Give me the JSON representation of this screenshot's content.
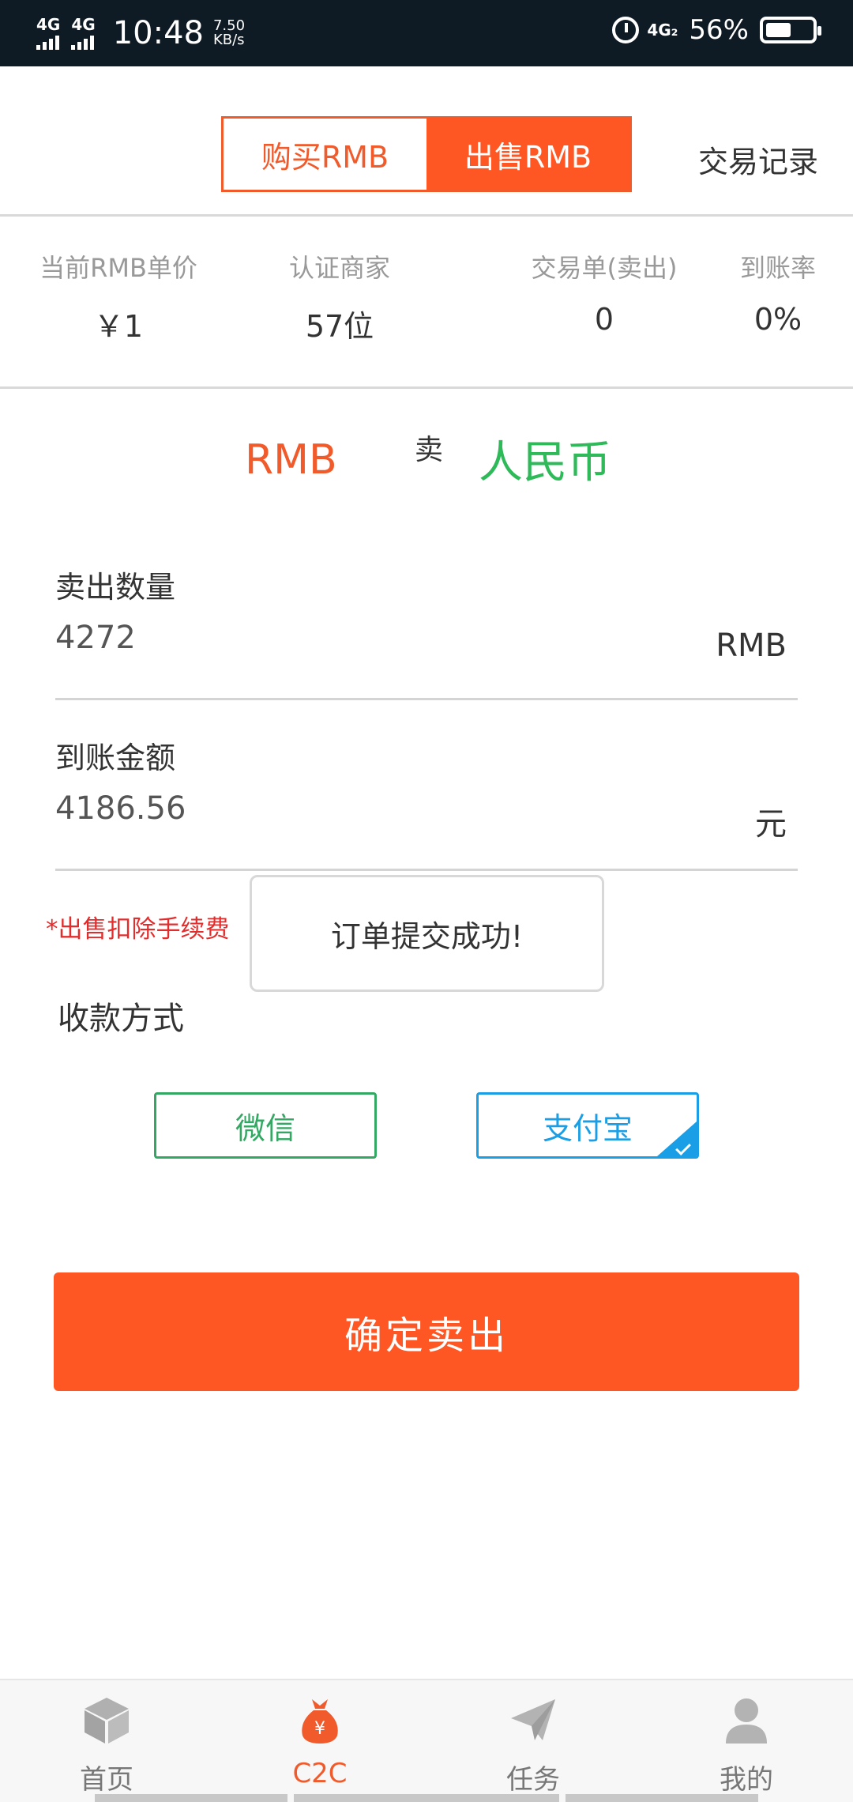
{
  "status_bar": {
    "signal1": "4G",
    "signal2": "4G",
    "time": "10:48",
    "speed_value": "7.50",
    "speed_unit": "KB/s",
    "network": "4G₂",
    "battery_percent": "56%",
    "battery_level": 0.56
  },
  "header": {
    "tab_buy": "购买RMB",
    "tab_sell": "出售RMB",
    "records": "交易记录",
    "active_tab": "sell",
    "accent_color": "#ff5724"
  },
  "stats": [
    {
      "label": "当前RMB单价",
      "value": "￥1"
    },
    {
      "label": "认证商家",
      "value": "57位"
    },
    {
      "label": "交易单(卖出)",
      "value": "0"
    },
    {
      "label": "到账率",
      "value": "0%"
    }
  ],
  "pair": {
    "left": "RMB",
    "mid": "卖",
    "right": "人民币"
  },
  "form": {
    "qty_label": "卖出数量",
    "qty_value": "4272",
    "qty_unit": "RMB",
    "amount_label": "到账金额",
    "amount_value": "4186.56",
    "amount_unit": "元",
    "fee_note": "*出售扣除手续费",
    "pay_label": "收款方式",
    "pay_wechat": "微信",
    "pay_alipay": "支付宝",
    "pay_selected": "alipay"
  },
  "confirm_button": "确定卖出",
  "toast": "订单提交成功!",
  "bottom_nav": [
    {
      "label": "首页",
      "icon": "cube-icon"
    },
    {
      "label": "C2C",
      "icon": "money-bag-icon"
    },
    {
      "label": "任务",
      "icon": "paper-plane-icon"
    },
    {
      "label": "我的",
      "icon": "user-icon"
    }
  ]
}
